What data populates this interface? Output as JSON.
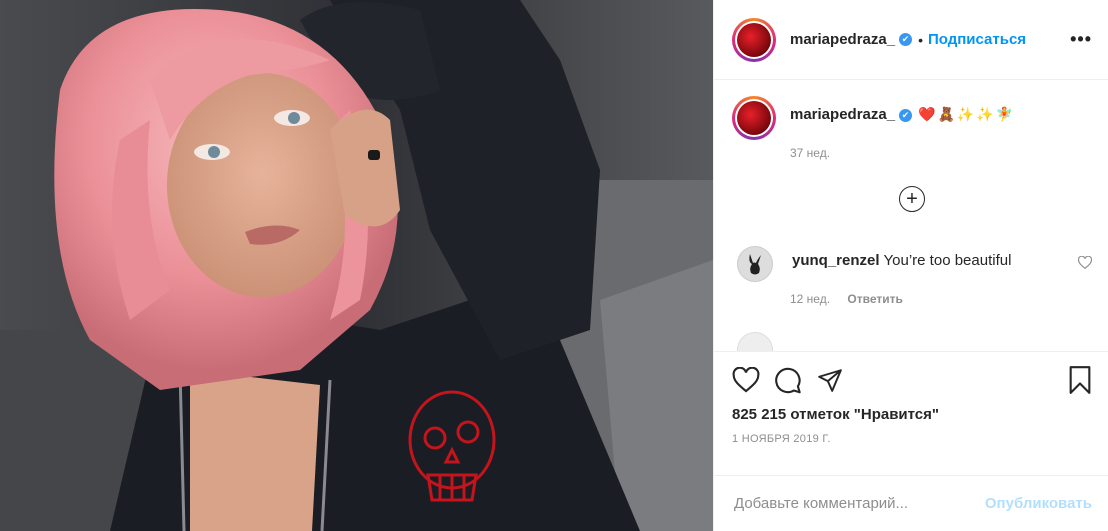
{
  "post": {
    "photo_alt": "",
    "header": {
      "username": "mariapedraza_",
      "verified_mark": "✔",
      "separator": "•",
      "follow_label": "Подписаться",
      "more_label": "•••"
    },
    "caption": {
      "username": "mariapedraza_",
      "verified_mark": "✔",
      "emoji": "❤️🧸✨✨🧚",
      "time": "37 нед."
    },
    "load_more_label": "+",
    "comments": [
      {
        "username": "yunq_renzel",
        "text": "You’re too beautiful",
        "time": "12 нед.",
        "reply_label": "Ответить",
        "avatar_icon": "playboy-bunny-icon"
      },
      {
        "username": "",
        "text": "",
        "time": "",
        "reply_label": ""
      }
    ],
    "actions": {
      "like_icon": "heart-icon",
      "comment_icon": "comment-icon",
      "share_icon": "share-icon",
      "save_icon": "bookmark-icon"
    },
    "likes_text": "825 215 отметок \"Нравится\"",
    "date": "1 НОЯБРЯ 2019 Г.",
    "add_comment": {
      "placeholder": "Добавьте комментарий...",
      "publish_label": "Опубликовать"
    },
    "colors": {
      "accent": "#0095f6",
      "publish_disabled": "#b2dffc",
      "muted": "#8e8e8e",
      "hair": "#f0a3a8",
      "hoodie": "#1b1d24",
      "skull": "#c4141c"
    }
  }
}
